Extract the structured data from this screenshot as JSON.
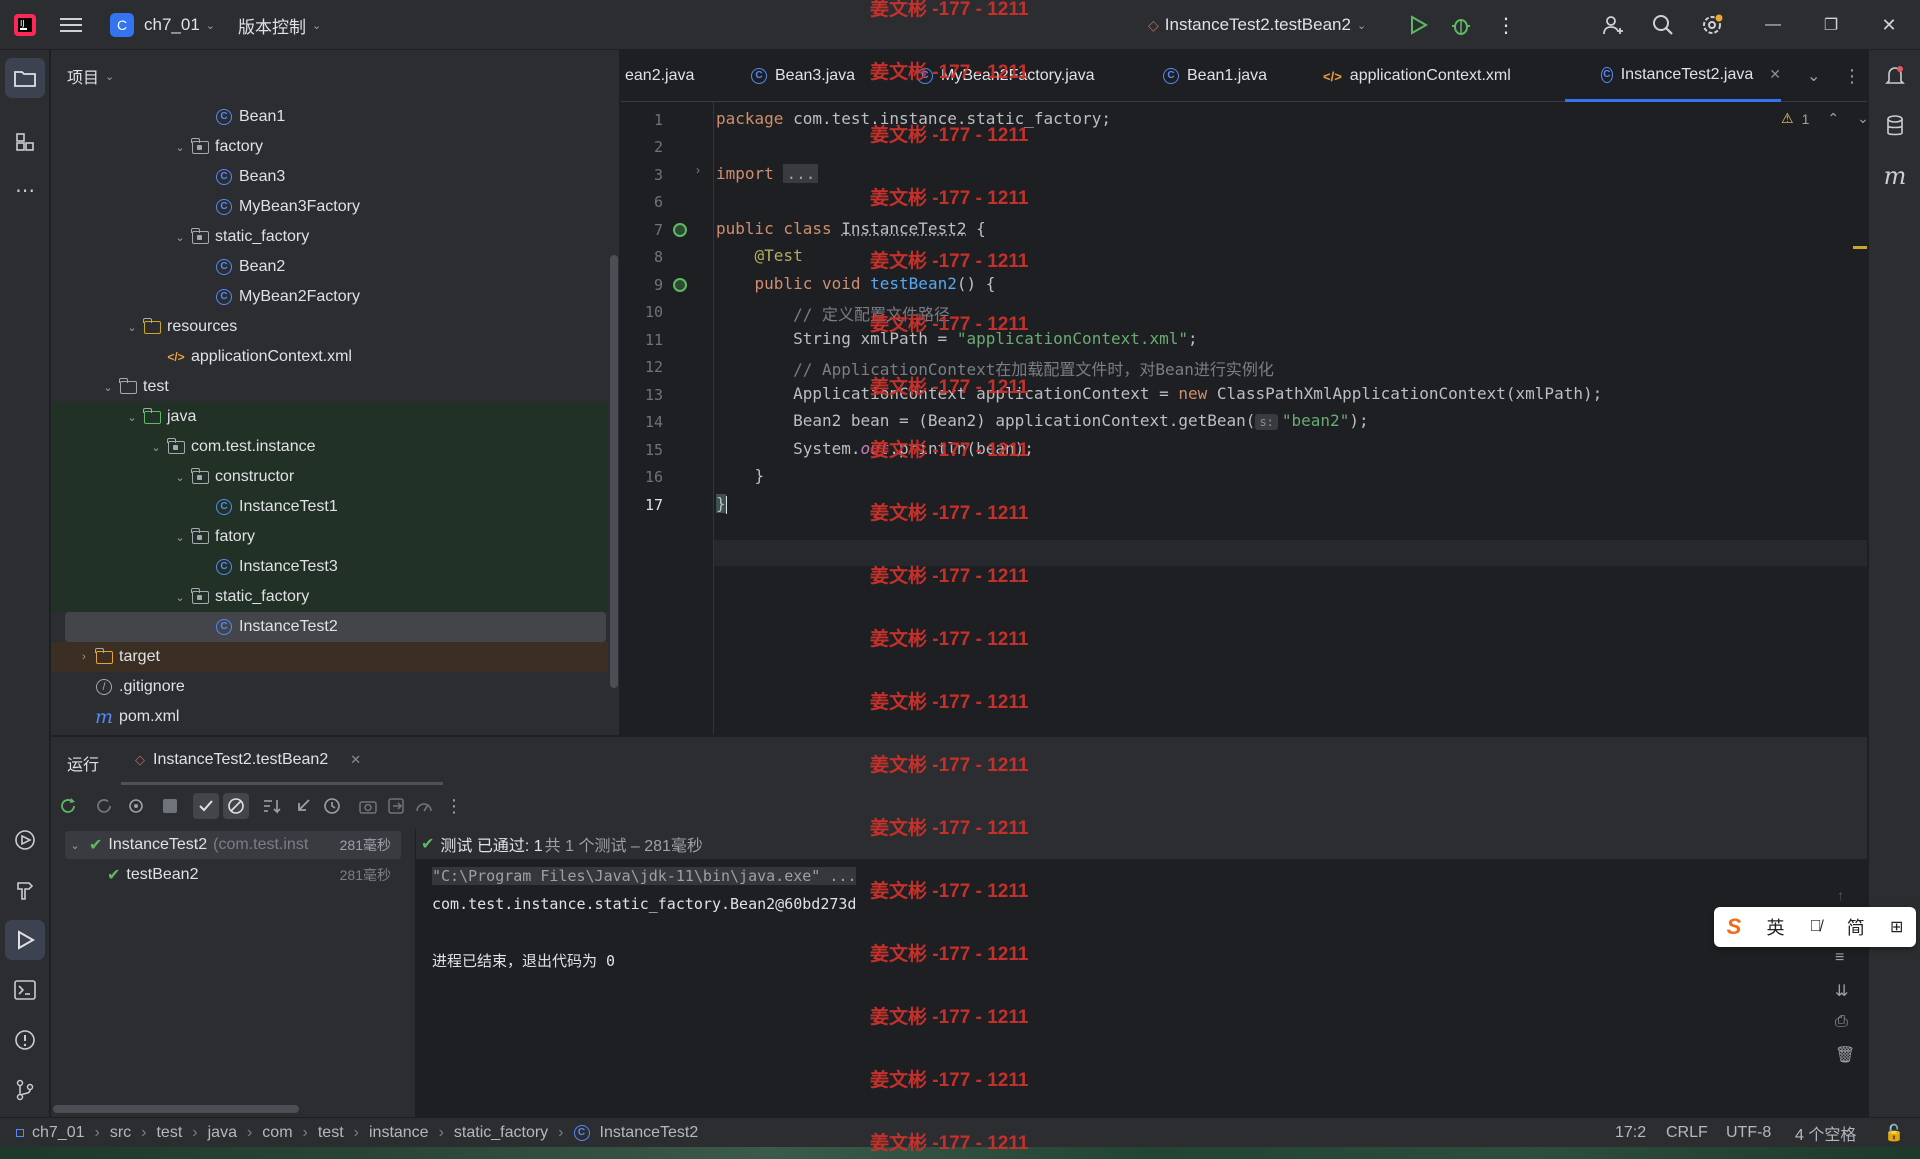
{
  "title_bar": {
    "project_badge": "C",
    "project": "ch7_01",
    "vcs": "版本控制",
    "run_config": "InstanceTest2.testBean2"
  },
  "project_panel": {
    "title": "项目",
    "tree": [
      {
        "label": "Bean1",
        "type": "class",
        "depth": 7
      },
      {
        "label": "factory",
        "type": "package",
        "depth": 6,
        "chev": "open"
      },
      {
        "label": "Bean3",
        "type": "class",
        "depth": 7
      },
      {
        "label": "MyBean3Factory",
        "type": "class",
        "depth": 7
      },
      {
        "label": "static_factory",
        "type": "package",
        "depth": 6,
        "chev": "open"
      },
      {
        "label": "Bean2",
        "type": "class",
        "depth": 7
      },
      {
        "label": "MyBean2Factory",
        "type": "class",
        "depth": 7
      },
      {
        "label": "resources",
        "type": "resfolder",
        "depth": 4,
        "chev": "open"
      },
      {
        "label": "applicationContext.xml",
        "type": "xml",
        "depth": 5
      },
      {
        "label": "test",
        "type": "folder",
        "depth": 3,
        "chev": "open"
      },
      {
        "label": "java",
        "type": "testfolder",
        "depth": 4,
        "chev": "open",
        "bg": "green"
      },
      {
        "label": "com.test.instance",
        "type": "package",
        "depth": 5,
        "chev": "open",
        "bg": "green"
      },
      {
        "label": "constructor",
        "type": "package",
        "depth": 6,
        "chev": "open",
        "bg": "green"
      },
      {
        "label": "InstanceTest1",
        "type": "class",
        "depth": 7,
        "bg": "green"
      },
      {
        "label": "fatory",
        "type": "package",
        "depth": 6,
        "chev": "open",
        "bg": "green"
      },
      {
        "label": "InstanceTest3",
        "type": "class",
        "depth": 7,
        "bg": "green"
      },
      {
        "label": "static_factory",
        "type": "package",
        "depth": 6,
        "chev": "open",
        "bg": "green"
      },
      {
        "label": "InstanceTest2",
        "type": "class",
        "depth": 7,
        "bg": "selected"
      },
      {
        "label": "target",
        "type": "folder-orange",
        "depth": 2,
        "chev": "closed",
        "bg": "orange"
      },
      {
        "label": ".gitignore",
        "type": "ignore",
        "depth": 2
      },
      {
        "label": "pom.xml",
        "type": "maven",
        "depth": 2
      }
    ]
  },
  "editor": {
    "tabs": [
      {
        "label": "ean2.java",
        "type": "class"
      },
      {
        "label": "Bean3.java",
        "type": "class"
      },
      {
        "label": "MyBean2Factory.java",
        "type": "class"
      },
      {
        "label": "Bean1.java",
        "type": "class"
      },
      {
        "label": "applicationContext.xml",
        "type": "xml"
      },
      {
        "label": "InstanceTest2.java",
        "type": "class",
        "active": true
      }
    ],
    "warning_count": "1",
    "line_numbers": [
      "1",
      "2",
      "3",
      "6",
      "7",
      "8",
      "9",
      "10",
      "11",
      "12",
      "13",
      "14",
      "15",
      "16",
      "17"
    ],
    "code": {
      "pkg_kw": "package",
      "pkg": " com.test.instance.static_factory;",
      "imp_kw": "import",
      "imp": "...",
      "l7_kw": "public class",
      "l7_name": "InstanceTest2",
      "l7_tail": " {",
      "l8": "@Test",
      "l9_kw": "public void",
      "l9_fn": "testBean2",
      "l9_tail": "() {",
      "l10": "// 定义配置文件路径",
      "l11_a": "String xmlPath = ",
      "l11_s": "\"applicationContext.xml\"",
      "l11_b": ";",
      "l12": "// ApplicationContext在加载配置文件时，对Bean进行实例化",
      "l13_a": "ApplicationContext applicationContext = ",
      "l13_kw": "new",
      "l13_b": " ClassPathXmlApplicationContext(xmlPath);",
      "l14_a": "Bean2 bean = (Bean2) applicationContext.getBean(",
      "l14_hint": "s:",
      "l14_s": "\"bean2\"",
      "l14_b": ");",
      "l15_a": "System.",
      "l15_it": "out",
      "l15_b": ".println(bean);",
      "l16": "}",
      "l17": "}"
    }
  },
  "run_panel": {
    "title": "运行",
    "tab": "InstanceTest2.testBean2",
    "test_root": "InstanceTest2",
    "test_root_pkg": "(com.test.inst",
    "test_root_time": "281毫秒",
    "test_child": "testBean2",
    "test_child_time": "281毫秒",
    "summary_a": "测试 已通过: 1",
    "summary_b": "共 1 个测试 – 281毫秒",
    "console": [
      "\"C:\\Program Files\\Java\\jdk-11\\bin\\java.exe\" ...",
      "com.test.instance.static_factory.Bean2@60bd273d",
      "",
      "进程已结束，退出代码为 0"
    ]
  },
  "status_bar": {
    "breadcrumbs": [
      "ch7_01",
      "src",
      "test",
      "java",
      "com",
      "test",
      "instance",
      "static_factory",
      "InstanceTest2"
    ],
    "position": "17:2",
    "line_sep": "CRLF",
    "encoding": "UTF-8",
    "indent": "4 个空格"
  },
  "watermark": "姜文彬 -177 - 1211",
  "ime": {
    "lang": "英",
    "mode": "简"
  },
  "colors": {
    "accent": "#3574f0",
    "green_pass": "#5fb865",
    "watermark": "#c4312b"
  }
}
